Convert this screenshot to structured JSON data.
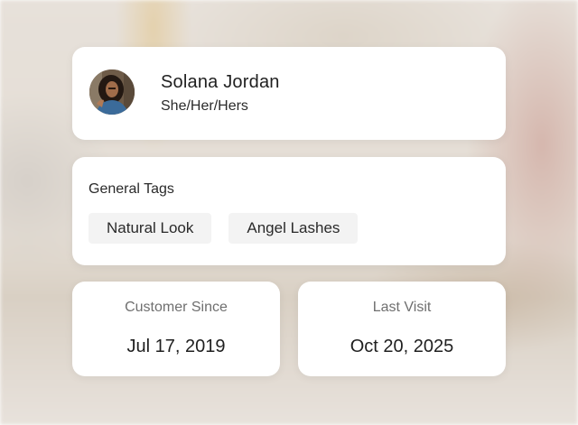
{
  "profile": {
    "name": "Solana Jordan",
    "pronouns": "She/Her/Hers"
  },
  "tags": {
    "title": "General Tags",
    "items": [
      "Natural Look",
      "Angel Lashes"
    ]
  },
  "stats": {
    "customer_since": {
      "label": "Customer Since",
      "value": "Jul 17, 2019"
    },
    "last_visit": {
      "label": "Last Visit",
      "value": "Oct 20, 2025"
    }
  }
}
